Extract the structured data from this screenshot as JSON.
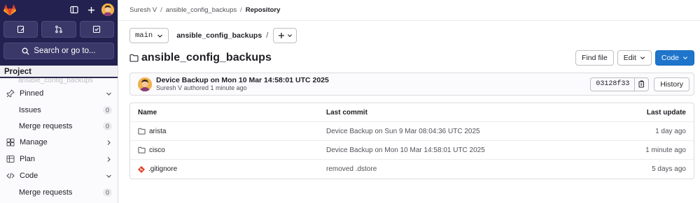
{
  "sidebar": {
    "search_label": "Search or go to...",
    "context_label": "Project",
    "ghost_label": "ansible_config_backups",
    "items": [
      {
        "label": "Pinned"
      },
      {
        "label": "Issues",
        "count": "0"
      },
      {
        "label": "Merge requests",
        "count": "0"
      },
      {
        "label": "Manage"
      },
      {
        "label": "Plan"
      },
      {
        "label": "Code"
      },
      {
        "label": "Merge requests",
        "count": "0"
      }
    ]
  },
  "breadcrumbs": [
    "Suresh V",
    "ansible_config_backups",
    "Repository"
  ],
  "ref": {
    "branch": "main",
    "path": "ansible_config_backups",
    "path_sep": "/"
  },
  "repo": {
    "title": "ansible_config_backups",
    "find_file": "Find file",
    "edit": "Edit",
    "code": "Code"
  },
  "last_commit": {
    "title": "Device Backup on Mon 10 Mar 14:58:01 UTC 2025",
    "meta": "Suresh V authored 1 minute ago",
    "sha": "03128f33",
    "history": "History"
  },
  "table": {
    "headers": {
      "name": "Name",
      "commit": "Last commit",
      "update": "Last update"
    },
    "rows": [
      {
        "name": "arista",
        "type": "folder",
        "commit": "Device Backup on Sun 9 Mar 08:04:36 UTC 2025",
        "update": "1 day ago"
      },
      {
        "name": "cisco",
        "type": "folder",
        "commit": "Device Backup on Mon 10 Mar 14:58:01 UTC 2025",
        "update": "1 minute ago"
      },
      {
        "name": ".gitignore",
        "type": "git-file",
        "commit": "removed .dstore",
        "update": "5 days ago"
      }
    ]
  },
  "colors": {
    "sidebar_top": "#232150",
    "primary": "#1f75cb",
    "gitlab_orange": "#e24329"
  }
}
